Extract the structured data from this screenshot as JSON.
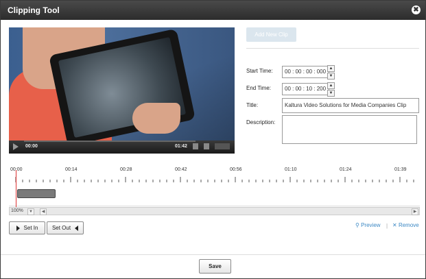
{
  "window": {
    "title": "Clipping Tool",
    "close_glyph": "✖"
  },
  "player": {
    "current_time": "00:00",
    "duration": "01:42",
    "icons": [
      "play-icon",
      "volume-icon",
      "fullscreen-icon",
      "kaltura-logo-icon"
    ]
  },
  "form": {
    "add_clip_label": "Add New Clip",
    "start_time_label": "Start Time:",
    "start_time_value": "00 : 00 : 00 : 000",
    "end_time_label": "End Time:",
    "end_time_value": "00 : 00 : 10 : 200",
    "title_label": "Title:",
    "title_value": "Kaltura Video Solutions for Media Companies Clip",
    "description_label": "Description:",
    "description_value": ""
  },
  "timeline": {
    "ticks": [
      "00:00",
      "00:14",
      "00:28",
      "00:42",
      "00:56",
      "01:10",
      "01:24",
      "01:39"
    ],
    "zoom": "100%"
  },
  "actions": {
    "set_in": "Set In",
    "set_out": "Set Out",
    "preview": "Preview",
    "remove": "Remove",
    "save": "Save"
  },
  "colors": {
    "link": "#3b88c4",
    "playhead": "#dd3333",
    "titlebar": "#333333"
  }
}
